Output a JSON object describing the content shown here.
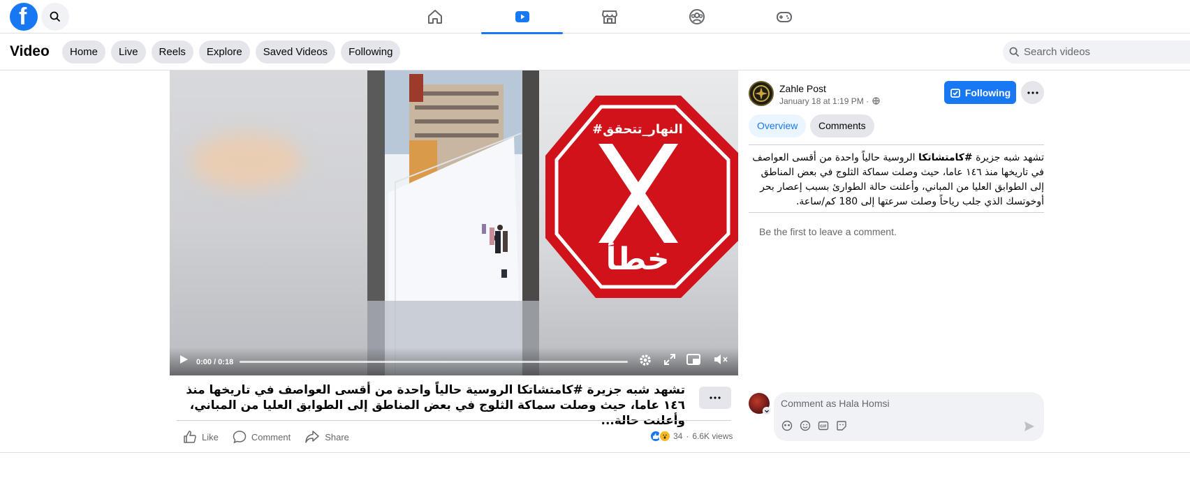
{
  "topnav": {
    "logo_letter": "f",
    "icons": [
      "home-icon",
      "video-icon",
      "marketplace-icon",
      "groups-icon",
      "gaming-icon"
    ],
    "active": "video-icon"
  },
  "subheader": {
    "title": "Video",
    "pills": [
      "Home",
      "Live",
      "Reels",
      "Explore",
      "Saved Videos",
      "Following"
    ],
    "search_placeholder": "Search videos"
  },
  "video": {
    "overlay_hashtag": "#النهار_تتحقق",
    "overlay_verdict": "خطأ",
    "time": "0:00 / 0:18",
    "progress": 0
  },
  "post": {
    "caption": "تشهد شبه جزيرة #كامتشاتكا الروسية حالياً واحدة من أقسى العواصف في تاريخها منذ ١٤٦ عاما، حيث وصلت سماكة الثلوج في بعض المناطق إلى الطوابق العليا من المباني، وأعلنت حالة...",
    "actions": {
      "like": "Like",
      "comment": "Comment",
      "share": "Share"
    },
    "reaction_count": "34",
    "views": "6.6K views"
  },
  "sidebar": {
    "page_name": "Zahle Post",
    "post_time": "January 18 at 1:19 PM ·",
    "following_label": "Following",
    "tabs": [
      "Overview",
      "Comments"
    ],
    "description_pre": "تشهد شبه جزيرة ",
    "description_hashtag": "#كامتشاتكا",
    "description_post": " الروسية حالياً واحدة من أقسى العواصف في تاريخها منذ ١٤٦ عاما، حيث وصلت سماكة الثلوج في بعض المناطق إلى الطوابق العليا من المباني، وأعلنت حالة الطوارئ بسبب إعصار بحر أوخوتسك الذي جلب رياحاً وصلت سرعتها إلى 180 كم/ساعة.",
    "empty_comments": "Be the first to leave a comment.",
    "comment_placeholder": "Comment as Hala Homsi"
  },
  "colors": {
    "brand": "#1877f2",
    "stop_red": "#d0121b"
  }
}
